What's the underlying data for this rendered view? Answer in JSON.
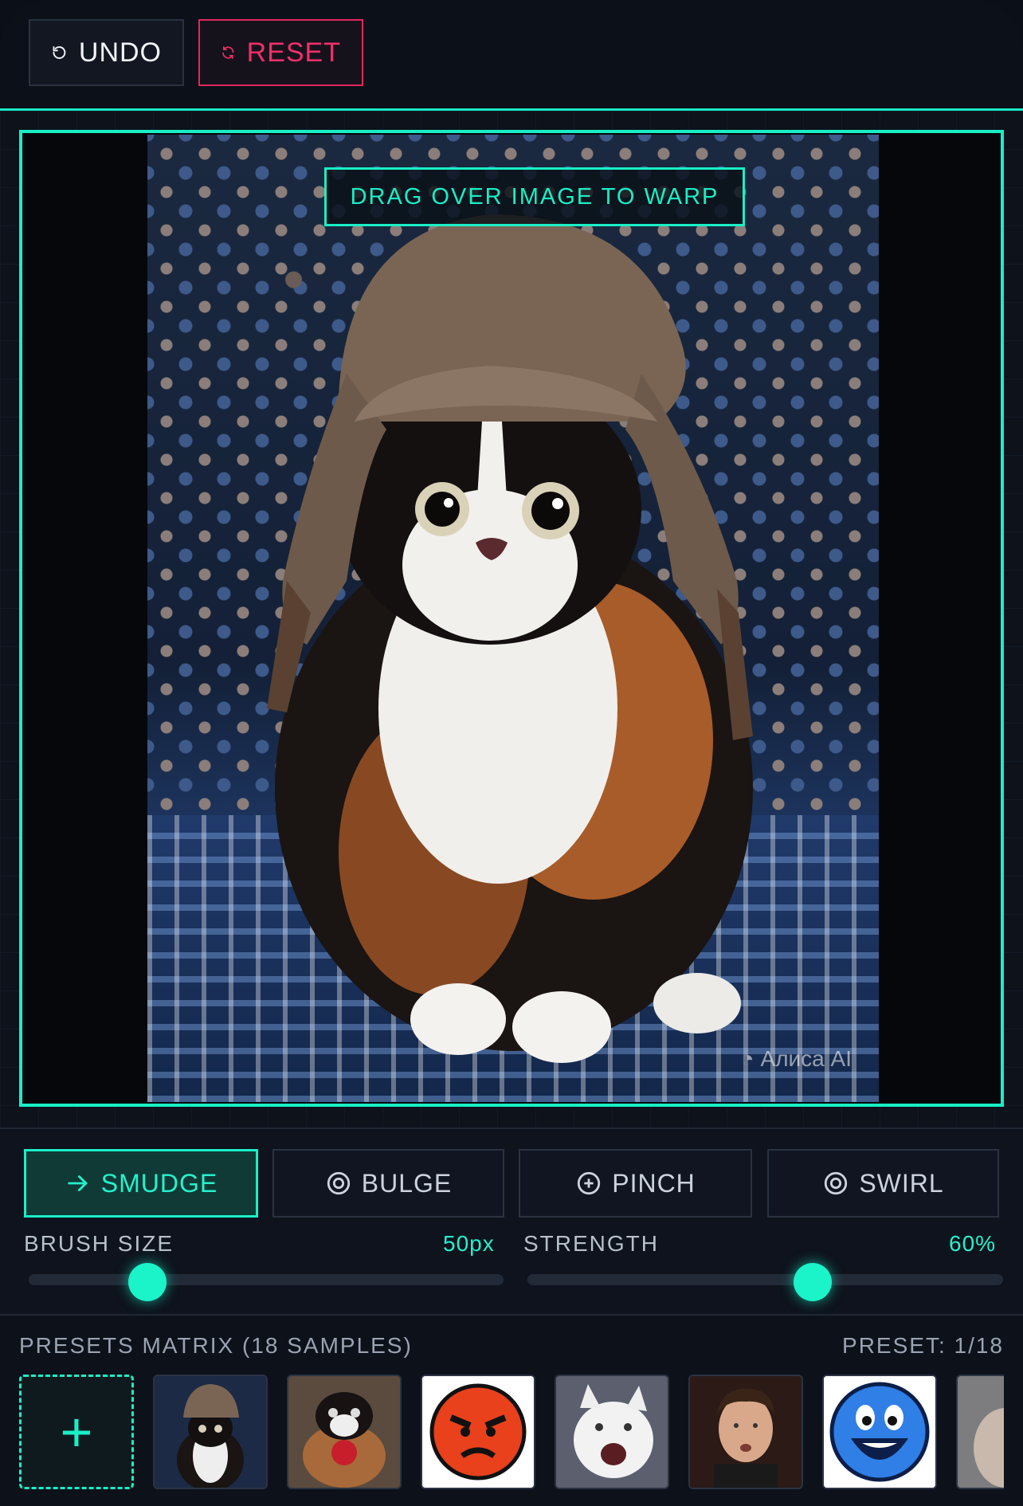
{
  "toolbar": {
    "undo_label": "UNDO",
    "reset_label": "RESET"
  },
  "canvas": {
    "hint": "DRAG OVER IMAGE TO WARP",
    "watermark": "Алиса AI"
  },
  "tools": [
    {
      "label": "SMUDGE",
      "icon": "arrow-right-icon",
      "active": true
    },
    {
      "label": "BULGE",
      "icon": "target-icon",
      "active": false
    },
    {
      "label": "PINCH",
      "icon": "plus-circle-icon",
      "active": false
    },
    {
      "label": "SWIRL",
      "icon": "target-icon",
      "active": false
    }
  ],
  "sliders": {
    "brush": {
      "label": "BRUSH SIZE",
      "value": "50px",
      "fraction": 0.25
    },
    "strength": {
      "label": "STRENGTH",
      "value": "60%",
      "fraction": 0.6
    }
  },
  "presets": {
    "title": "PRESETS MATRIX (18 SAMPLES)",
    "counter": "PRESET: 1/18",
    "add_icon": "+",
    "items": [
      "cat-hat",
      "cat-apple",
      "angry-face",
      "screaming-cat",
      "man-portrait",
      "happy-face",
      "partial"
    ]
  },
  "colors": {
    "accent": "#19efc6",
    "danger": "#e0275e",
    "background": "#0f131d"
  }
}
